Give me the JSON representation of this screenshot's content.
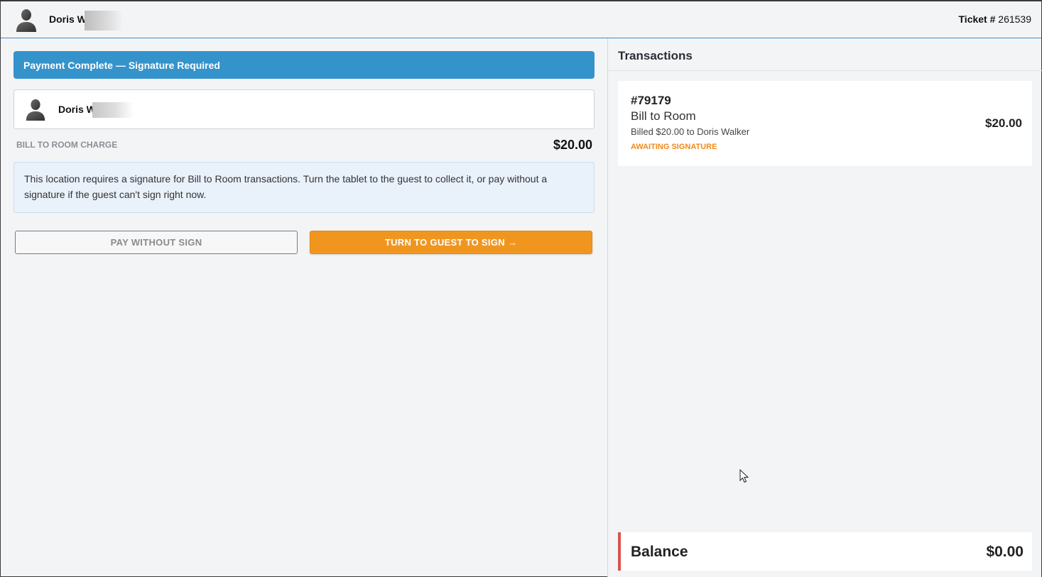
{
  "header": {
    "guest_name": "Doris W",
    "ticket_label": "Ticket #",
    "ticket_number": "261539"
  },
  "main": {
    "banner": "Payment Complete — Signature Required",
    "guest_card_name": "Doris W",
    "charge_label": "BILL TO ROOM CHARGE",
    "charge_amount": "$20.00",
    "info_text": "This location requires a signature for Bill to Room transactions. Turn the tablet to the guest to collect it, or pay without a signature if the guest can't sign right now.",
    "pay_without_sign_label": "PAY WITHOUT SIGN",
    "turn_to_guest_label": "TURN TO GUEST TO SIGN →"
  },
  "transactions": {
    "title": "Transactions",
    "items": [
      {
        "id": "#79179",
        "type": "Bill to Room",
        "billed": "Billed $20.00 to Doris Walker",
        "status": "AWAITING SIGNATURE",
        "amount": "$20.00"
      }
    ],
    "balance_label": "Balance",
    "balance_value": "$0.00"
  },
  "colors": {
    "banner": "#3593cc",
    "primary_button": "#f0961f",
    "status_awaiting": "#ee8a1d",
    "balance_accent": "#d9534f"
  },
  "icons": {
    "avatar": "person-silhouette-icon",
    "cursor": "mouse-pointer-icon"
  }
}
